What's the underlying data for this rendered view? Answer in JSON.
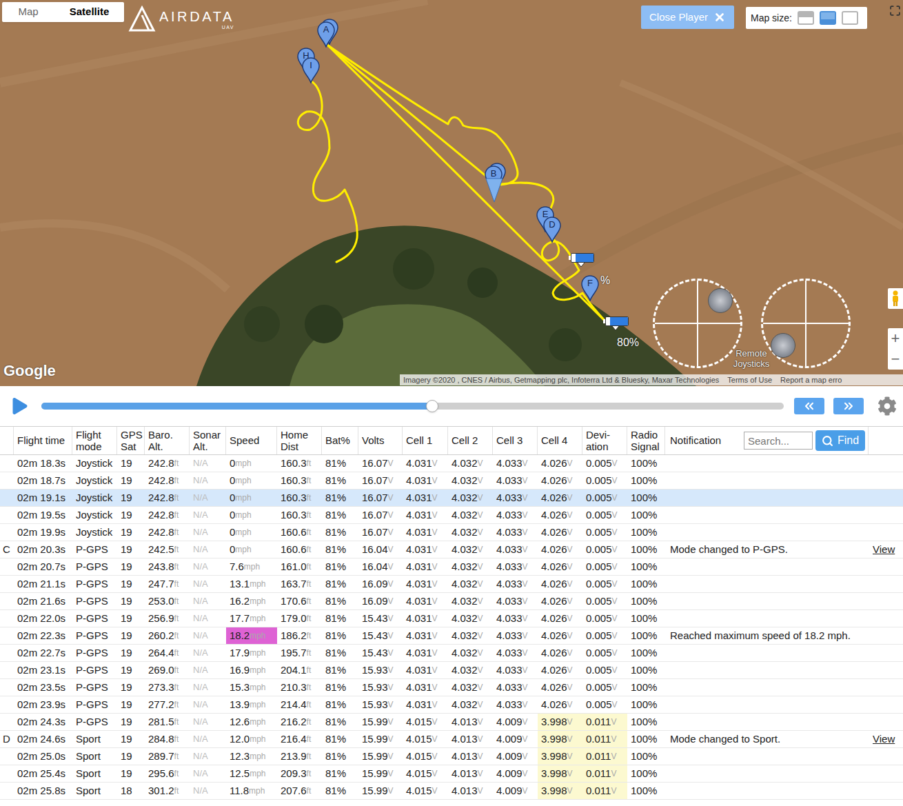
{
  "map": {
    "type_toggle": [
      {
        "label": "Map",
        "selected": false
      },
      {
        "label": "Satellite",
        "selected": true
      }
    ],
    "logo": {
      "name": "AIRDATA",
      "sub": "UAV"
    },
    "close_button": {
      "label": "Close Player"
    },
    "map_size": {
      "label": "Map size:",
      "options": [
        {
          "kind": "small",
          "selected": false
        },
        {
          "kind": "medium",
          "selected": true
        },
        {
          "kind": "large",
          "selected": false
        }
      ]
    },
    "pins": [
      {
        "label": "G"
      },
      {
        "label": "A"
      },
      {
        "label": "H"
      },
      {
        "label": "I"
      },
      {
        "label": "C"
      },
      {
        "label": "B"
      },
      {
        "label": "E"
      },
      {
        "label": "D"
      },
      {
        "label": "F"
      }
    ],
    "batteries": [
      {
        "label": "%",
        "level": 0.8
      },
      {
        "label": "80%",
        "level": 0.8
      }
    ],
    "joysticks": {
      "label": "Remote Joysticks",
      "sticks": [
        {
          "x": 0.54,
          "y": -0.54
        },
        {
          "x": -0.54,
          "y": 0.52
        }
      ]
    },
    "zoom": [
      "+",
      "−"
    ],
    "google": "Google",
    "attribution": {
      "text": "Imagery ©2020 , CNES / Airbus, Getmapping plc, Infoterra Ltd & Bluesky, Maxar Technologies",
      "links": [
        "Terms of Use",
        "Report a map erro"
      ]
    }
  },
  "player": {
    "playing": false,
    "level": 0.526
  },
  "table": {
    "columns": [
      {
        "key": "time",
        "label": [
          "Flight time"
        ]
      },
      {
        "key": "mode",
        "label": [
          "Flight",
          "mode"
        ]
      },
      {
        "key": "gps",
        "label": [
          "GPS",
          "Sat"
        ]
      },
      {
        "key": "baro",
        "label": [
          "Baro.",
          "Alt."
        ],
        "unit": "ft"
      },
      {
        "key": "sonar",
        "label": [
          "Sonar",
          "Alt."
        ],
        "muted": true
      },
      {
        "key": "speed",
        "label": [
          "Speed"
        ],
        "unit": "mph"
      },
      {
        "key": "home",
        "label": [
          "Home",
          "Dist"
        ],
        "unit": "ft"
      },
      {
        "key": "bat",
        "label": [
          "Bat%"
        ]
      },
      {
        "key": "volts",
        "label": [
          "Volts"
        ],
        "unit": "V"
      },
      {
        "key": "c1",
        "label": [
          "Cell 1"
        ],
        "unit": "V"
      },
      {
        "key": "c2",
        "label": [
          "Cell 2"
        ],
        "unit": "V"
      },
      {
        "key": "c3",
        "label": [
          "Cell 3"
        ],
        "unit": "V"
      },
      {
        "key": "c4",
        "label": [
          "Cell 4"
        ],
        "unit": "V"
      },
      {
        "key": "dev",
        "label": [
          "Devi-",
          "ation"
        ],
        "unit": "V"
      },
      {
        "key": "radio",
        "label": [
          "Radio",
          "Signal"
        ]
      },
      {
        "key": "note",
        "label": [
          "Notification"
        ]
      }
    ],
    "search": {
      "placeholder": "Search..."
    },
    "find": "Find",
    "rows": [
      {
        "marker": "",
        "time": "02m 18.3s",
        "mode": "Joystick",
        "gps": "19",
        "baro": "242.8",
        "sonar": "N/A",
        "speed": "0",
        "home": "160.3",
        "bat": "81%",
        "volts": "16.07",
        "c1": "4.031",
        "c2": "4.032",
        "c3": "4.033",
        "c4": "4.026",
        "dev": "0.005",
        "radio": "100%",
        "note": "",
        "view": "",
        "selected": false,
        "max_speed": false,
        "warn": false
      },
      {
        "marker": "",
        "time": "02m 18.7s",
        "mode": "Joystick",
        "gps": "19",
        "baro": "242.8",
        "sonar": "N/A",
        "speed": "0",
        "home": "160.3",
        "bat": "81%",
        "volts": "16.07",
        "c1": "4.031",
        "c2": "4.032",
        "c3": "4.033",
        "c4": "4.026",
        "dev": "0.005",
        "radio": "100%",
        "note": "",
        "view": "",
        "selected": false,
        "max_speed": false,
        "warn": false
      },
      {
        "marker": "",
        "time": "02m 19.1s",
        "mode": "Joystick",
        "gps": "19",
        "baro": "242.8",
        "sonar": "N/A",
        "speed": "0",
        "home": "160.3",
        "bat": "81%",
        "volts": "16.07",
        "c1": "4.031",
        "c2": "4.032",
        "c3": "4.033",
        "c4": "4.026",
        "dev": "0.005",
        "radio": "100%",
        "note": "",
        "view": "",
        "selected": true,
        "max_speed": false,
        "warn": false
      },
      {
        "marker": "",
        "time": "02m 19.5s",
        "mode": "Joystick",
        "gps": "19",
        "baro": "242.8",
        "sonar": "N/A",
        "speed": "0",
        "home": "160.3",
        "bat": "81%",
        "volts": "16.07",
        "c1": "4.031",
        "c2": "4.032",
        "c3": "4.033",
        "c4": "4.026",
        "dev": "0.005",
        "radio": "100%",
        "note": "",
        "view": "",
        "selected": false,
        "max_speed": false,
        "warn": false
      },
      {
        "marker": "",
        "time": "02m 19.9s",
        "mode": "Joystick",
        "gps": "19",
        "baro": "242.8",
        "sonar": "N/A",
        "speed": "0",
        "home": "160.6",
        "bat": "81%",
        "volts": "16.07",
        "c1": "4.031",
        "c2": "4.032",
        "c3": "4.033",
        "c4": "4.026",
        "dev": "0.005",
        "radio": "100%",
        "note": "",
        "view": "",
        "selected": false,
        "max_speed": false,
        "warn": false
      },
      {
        "marker": "C",
        "time": "02m 20.3s",
        "mode": "P-GPS",
        "gps": "19",
        "baro": "242.5",
        "sonar": "N/A",
        "speed": "0",
        "home": "160.6",
        "bat": "81%",
        "volts": "16.04",
        "c1": "4.031",
        "c2": "4.032",
        "c3": "4.033",
        "c4": "4.026",
        "dev": "0.005",
        "radio": "100%",
        "note": "Mode changed to P-GPS.",
        "view": "View",
        "selected": false,
        "max_speed": false,
        "warn": false
      },
      {
        "marker": "",
        "time": "02m 20.7s",
        "mode": "P-GPS",
        "gps": "19",
        "baro": "243.8",
        "sonar": "N/A",
        "speed": "7.6",
        "home": "161.0",
        "bat": "81%",
        "volts": "16.04",
        "c1": "4.031",
        "c2": "4.032",
        "c3": "4.033",
        "c4": "4.026",
        "dev": "0.005",
        "radio": "100%",
        "note": "",
        "view": "",
        "selected": false,
        "max_speed": false,
        "warn": false
      },
      {
        "marker": "",
        "time": "02m 21.1s",
        "mode": "P-GPS",
        "gps": "19",
        "baro": "247.7",
        "sonar": "N/A",
        "speed": "13.1",
        "home": "163.7",
        "bat": "81%",
        "volts": "16.09",
        "c1": "4.031",
        "c2": "4.032",
        "c3": "4.033",
        "c4": "4.026",
        "dev": "0.005",
        "radio": "100%",
        "note": "",
        "view": "",
        "selected": false,
        "max_speed": false,
        "warn": false
      },
      {
        "marker": "",
        "time": "02m 21.6s",
        "mode": "P-GPS",
        "gps": "19",
        "baro": "253.0",
        "sonar": "N/A",
        "speed": "16.2",
        "home": "170.6",
        "bat": "81%",
        "volts": "16.09",
        "c1": "4.031",
        "c2": "4.032",
        "c3": "4.033",
        "c4": "4.026",
        "dev": "0.005",
        "radio": "100%",
        "note": "",
        "view": "",
        "selected": false,
        "max_speed": false,
        "warn": false
      },
      {
        "marker": "",
        "time": "02m 22.0s",
        "mode": "P-GPS",
        "gps": "19",
        "baro": "256.9",
        "sonar": "N/A",
        "speed": "17.7",
        "home": "179.0",
        "bat": "81%",
        "volts": "15.43",
        "c1": "4.031",
        "c2": "4.032",
        "c3": "4.033",
        "c4": "4.026",
        "dev": "0.005",
        "radio": "100%",
        "note": "",
        "view": "",
        "selected": false,
        "max_speed": false,
        "warn": false
      },
      {
        "marker": "",
        "time": "02m 22.3s",
        "mode": "P-GPS",
        "gps": "19",
        "baro": "260.2",
        "sonar": "N/A",
        "speed": "18.2",
        "home": "186.2",
        "bat": "81%",
        "volts": "15.43",
        "c1": "4.031",
        "c2": "4.032",
        "c3": "4.033",
        "c4": "4.026",
        "dev": "0.005",
        "radio": "100%",
        "note": "Reached maximum speed of 18.2 mph.",
        "view": "",
        "selected": false,
        "max_speed": true,
        "warn": false
      },
      {
        "marker": "",
        "time": "02m 22.7s",
        "mode": "P-GPS",
        "gps": "19",
        "baro": "264.4",
        "sonar": "N/A",
        "speed": "17.9",
        "home": "195.7",
        "bat": "81%",
        "volts": "15.43",
        "c1": "4.031",
        "c2": "4.032",
        "c3": "4.033",
        "c4": "4.026",
        "dev": "0.005",
        "radio": "100%",
        "note": "",
        "view": "",
        "selected": false,
        "max_speed": false,
        "warn": false
      },
      {
        "marker": "",
        "time": "02m 23.1s",
        "mode": "P-GPS",
        "gps": "19",
        "baro": "269.0",
        "sonar": "N/A",
        "speed": "16.9",
        "home": "204.1",
        "bat": "81%",
        "volts": "15.93",
        "c1": "4.031",
        "c2": "4.032",
        "c3": "4.033",
        "c4": "4.026",
        "dev": "0.005",
        "radio": "100%",
        "note": "",
        "view": "",
        "selected": false,
        "max_speed": false,
        "warn": false
      },
      {
        "marker": "",
        "time": "02m 23.5s",
        "mode": "P-GPS",
        "gps": "19",
        "baro": "273.3",
        "sonar": "N/A",
        "speed": "15.3",
        "home": "210.3",
        "bat": "81%",
        "volts": "15.93",
        "c1": "4.031",
        "c2": "4.032",
        "c3": "4.033",
        "c4": "4.026",
        "dev": "0.005",
        "radio": "100%",
        "note": "",
        "view": "",
        "selected": false,
        "max_speed": false,
        "warn": false
      },
      {
        "marker": "",
        "time": "02m 23.9s",
        "mode": "P-GPS",
        "gps": "19",
        "baro": "277.2",
        "sonar": "N/A",
        "speed": "13.9",
        "home": "214.4",
        "bat": "81%",
        "volts": "15.93",
        "c1": "4.031",
        "c2": "4.032",
        "c3": "4.033",
        "c4": "4.026",
        "dev": "0.005",
        "radio": "100%",
        "note": "",
        "view": "",
        "selected": false,
        "max_speed": false,
        "warn": false
      },
      {
        "marker": "",
        "time": "02m 24.3s",
        "mode": "P-GPS",
        "gps": "19",
        "baro": "281.5",
        "sonar": "N/A",
        "speed": "12.6",
        "home": "216.2",
        "bat": "81%",
        "volts": "15.99",
        "c1": "4.015",
        "c2": "4.013",
        "c3": "4.009",
        "c4": "3.998",
        "dev": "0.011",
        "radio": "100%",
        "note": "",
        "view": "",
        "selected": false,
        "max_speed": false,
        "warn": true
      },
      {
        "marker": "D",
        "time": "02m 24.6s",
        "mode": "Sport",
        "gps": "19",
        "baro": "284.8",
        "sonar": "N/A",
        "speed": "12.0",
        "home": "216.4",
        "bat": "81%",
        "volts": "15.99",
        "c1": "4.015",
        "c2": "4.013",
        "c3": "4.009",
        "c4": "3.998",
        "dev": "0.011",
        "radio": "100%",
        "note": "Mode changed to Sport.",
        "view": "View",
        "selected": false,
        "max_speed": false,
        "warn": true
      },
      {
        "marker": "",
        "time": "02m 25.0s",
        "mode": "Sport",
        "gps": "19",
        "baro": "289.7",
        "sonar": "N/A",
        "speed": "12.3",
        "home": "213.9",
        "bat": "81%",
        "volts": "15.99",
        "c1": "4.015",
        "c2": "4.013",
        "c3": "4.009",
        "c4": "3.998",
        "dev": "0.011",
        "radio": "100%",
        "note": "",
        "view": "",
        "selected": false,
        "max_speed": false,
        "warn": true
      },
      {
        "marker": "",
        "time": "02m 25.4s",
        "mode": "Sport",
        "gps": "19",
        "baro": "295.6",
        "sonar": "N/A",
        "speed": "12.5",
        "home": "209.3",
        "bat": "81%",
        "volts": "15.99",
        "c1": "4.015",
        "c2": "4.013",
        "c3": "4.009",
        "c4": "3.998",
        "dev": "0.011",
        "radio": "100%",
        "note": "",
        "view": "",
        "selected": false,
        "max_speed": false,
        "warn": true
      },
      {
        "marker": "",
        "time": "02m 25.8s",
        "mode": "Sport",
        "gps": "18",
        "baro": "301.2",
        "sonar": "N/A",
        "speed": "11.8",
        "home": "207.6",
        "bat": "81%",
        "volts": "15.99",
        "c1": "4.015",
        "c2": "4.013",
        "c3": "4.009",
        "c4": "3.998",
        "dev": "0.011",
        "radio": "100%",
        "note": "",
        "view": "",
        "selected": false,
        "max_speed": false,
        "warn": true
      }
    ]
  }
}
